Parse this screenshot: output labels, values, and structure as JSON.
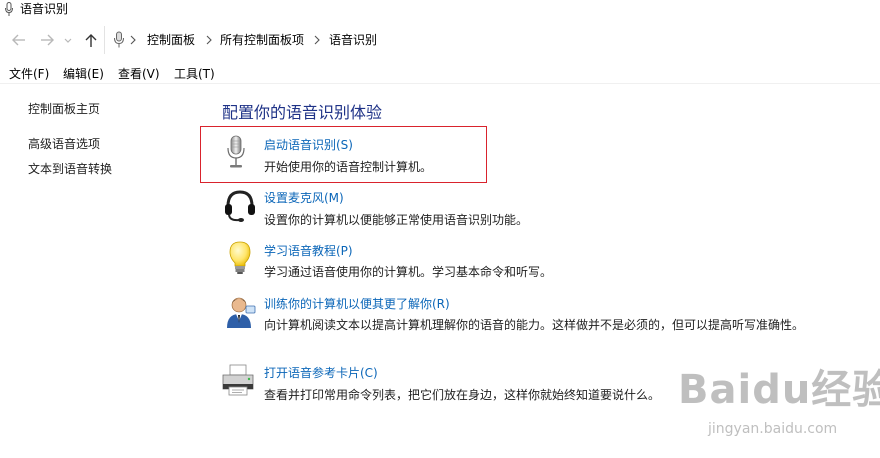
{
  "window": {
    "title": "语音识别"
  },
  "address": {
    "crumbs": [
      "控制面板",
      "所有控制面板项",
      "语音识别"
    ]
  },
  "menu": [
    "文件(F)",
    "编辑(E)",
    "查看(V)",
    "工具(T)"
  ],
  "sidebar": {
    "home": "控制面板主页",
    "links": [
      "高级语音选项",
      "文本到语音转换"
    ]
  },
  "main": {
    "title": "配置你的语音识别体验",
    "tasks": [
      {
        "icon": "microphone-icon",
        "link": "启动语音识别(S)",
        "desc": "开始使用你的语音控制计算机。"
      },
      {
        "icon": "headset-icon",
        "link": "设置麦克风(M)",
        "desc": "设置你的计算机以便能够正常使用语音识别功能。"
      },
      {
        "icon": "lightbulb-icon",
        "link": "学习语音教程(P)",
        "desc": "学习通过语音使用你的计算机。学习基本命令和听写。"
      },
      {
        "icon": "user-training-icon",
        "link": "训练你的计算机以便其更了解你(R)",
        "desc": "向计算机阅读文本以提高计算机理解你的语音的能力。这样做并不是必须的，但可以提高听写准确性。"
      },
      {
        "icon": "printer-icon",
        "link": "打开语音参考卡片(C)",
        "desc": "查看并打印常用命令列表，把它们放在身边，这样你就始终知道要说什么。"
      }
    ]
  },
  "watermark": {
    "text": "Baidu经验",
    "sub": "jingyan.baidu.com"
  },
  "colors": {
    "link": "#0b66b8",
    "title": "#1e3287",
    "highlight": "#d9232d"
  }
}
